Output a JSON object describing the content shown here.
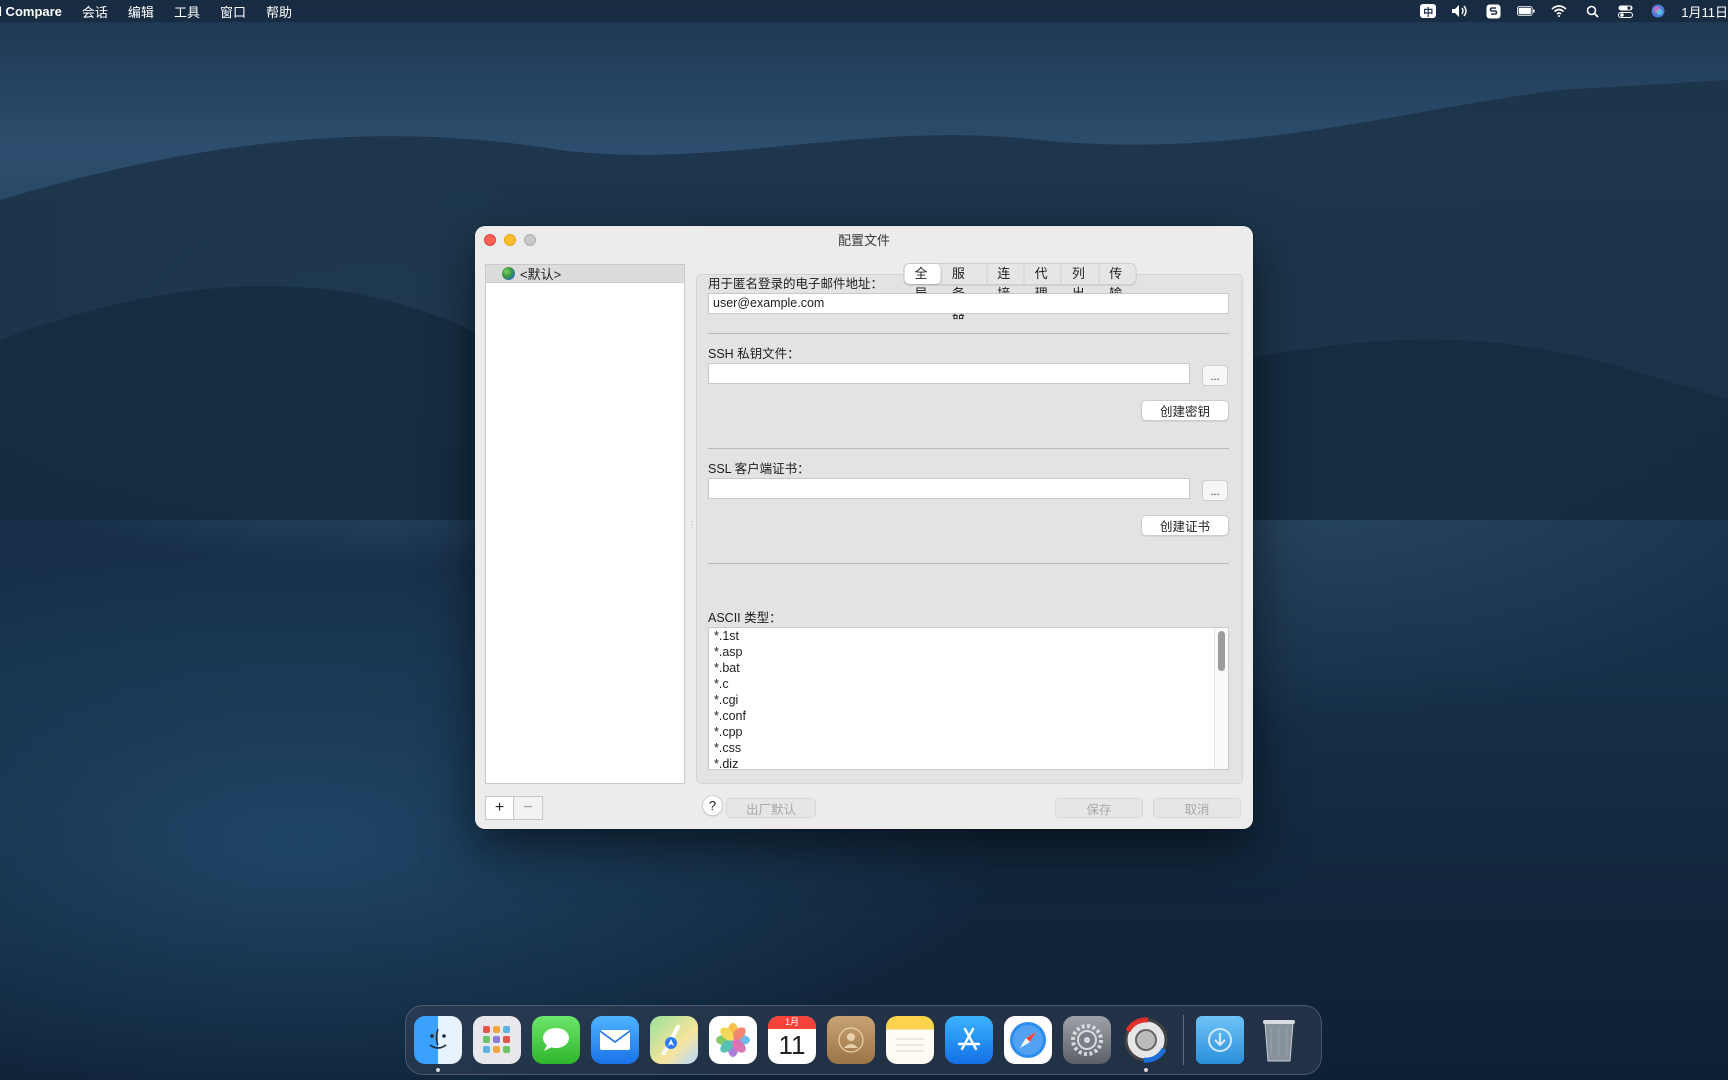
{
  "menubar": {
    "app_name": "d Compare",
    "items": [
      "会话",
      "编辑",
      "工具",
      "窗口",
      "帮助"
    ],
    "ime": "中",
    "clock": "1月11日"
  },
  "window": {
    "title": "配置文件",
    "profiles": [
      "<默认>"
    ],
    "add_label": "+",
    "remove_label": "−",
    "tabs": [
      "全局",
      "服务器",
      "连接",
      "代理",
      "列出",
      "传输"
    ],
    "active_tab": "全局",
    "email_label": "用于匿名登录的电子邮件地址：",
    "email_value": "user@example.com",
    "ssh_label": "SSH 私钥文件：",
    "ssh_value": "",
    "browse_label": "...",
    "create_key_label": "创建密钥",
    "ssl_label": "SSL 客户端证书：",
    "ssl_value": "",
    "create_cert_label": "创建证书",
    "ascii_label": "ASCII 类型：",
    "ascii_types": [
      "*.1st",
      "*.asp",
      "*.bat",
      "*.c",
      "*.cgi",
      "*.conf",
      "*.cpp",
      "*.css",
      "*.diz"
    ],
    "help_label": "?",
    "factory_default_label": "出厂默认",
    "save_label": "保存",
    "cancel_label": "取消"
  },
  "dock": {
    "apps": [
      "finder-icon",
      "launchpad-icon",
      "messages-icon",
      "mail-icon",
      "maps-icon",
      "photos-icon",
      "calendar-icon",
      "contacts-icon",
      "notes-icon",
      "app-store-icon",
      "safari-icon",
      "system-preferences-icon",
      "beyond-compare-icon"
    ],
    "calendar_month": "1月",
    "calendar_day": "11"
  }
}
